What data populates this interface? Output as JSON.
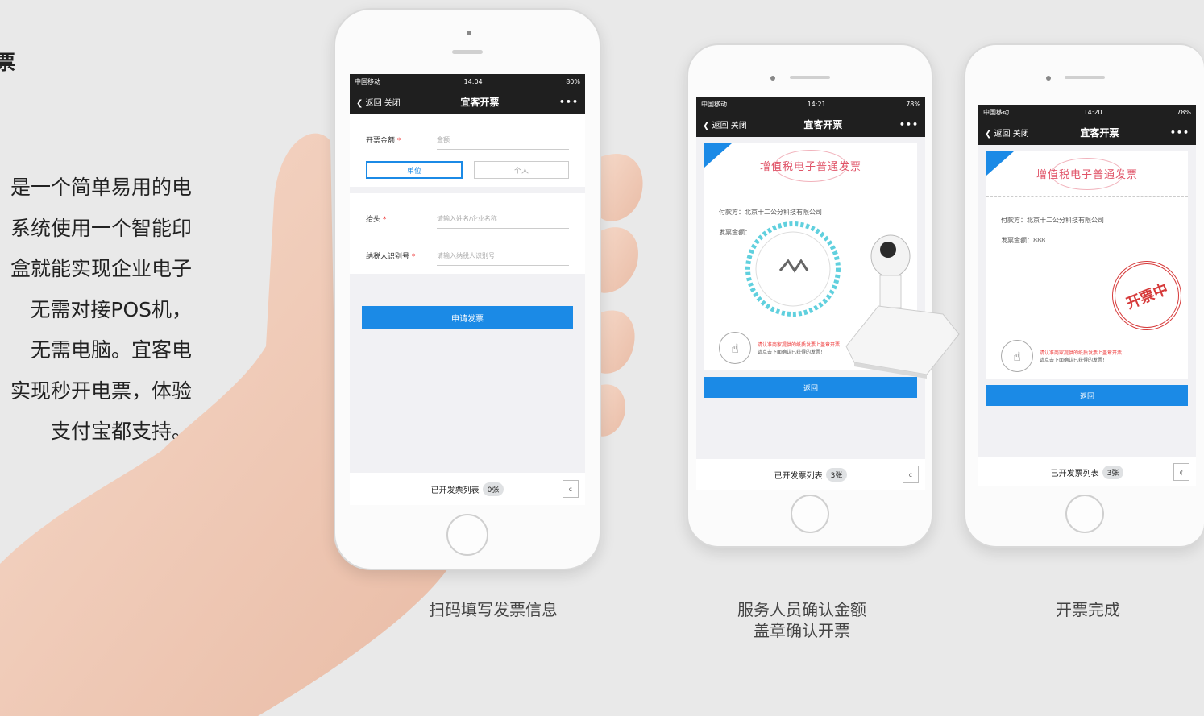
{
  "intro": {
    "title": "票",
    "lines": [
      "是一个简单易用的电",
      "系统使用一个智能印",
      "盒就能实现企业电子",
      "无需对接POS机，",
      "无需电脑。宜客电",
      "实现秒开电票，体验",
      "支付宝都支持。"
    ]
  },
  "phone1": {
    "status_left": "中国移动",
    "status_time": "14:04",
    "status_right": "80%",
    "nav_back": "返回",
    "nav_close": "关闭",
    "nav_title": "宜客开票",
    "nav_more": "•••",
    "field_amount_label": "开票金额",
    "field_amount_placeholder": "金额",
    "type_company": "单位",
    "type_personal": "个人",
    "field_header_label": "抬头",
    "field_header_placeholder": "请输入姓名/企业名称",
    "field_taxid_label": "纳税人识别号",
    "field_taxid_placeholder": "请输入纳税人识别号",
    "apply_button": "申请发票",
    "list_label": "已开发票列表",
    "list_count": "0张"
  },
  "phone2": {
    "status_left": "中国移动",
    "status_time": "14:21",
    "status_right": "78%",
    "nav_back": "返回",
    "nav_close": "关闭",
    "nav_title": "宜客开票",
    "nav_more": "•••",
    "card_title": "增值税电子普通发票",
    "payer_line": "付款方：北京十二公分科技有限公司",
    "amount_label": "发票金额：",
    "notice_line1": "请认准商家提供的纸质发票上盖章开票！",
    "notice_line2": "请点击下面确认已获得的发票！",
    "back_button": "返回",
    "list_label": "已开发票列表",
    "list_count": "3张"
  },
  "phone3": {
    "status_left": "中国移动",
    "status_time": "14:20",
    "status_right": "78%",
    "nav_back": "返回",
    "nav_close": "关闭",
    "nav_title": "宜客开票",
    "nav_more": "•••",
    "card_title": "增值税电子普通发票",
    "payer_line": "付款方：北京十二公分科技有限公司",
    "amount_line": "发票金额：888",
    "stamp_text": "开票中",
    "notice_line1": "请认准商家提供的纸质发票上盖章开票！",
    "notice_line2": "请点击下面确认已获得的发票！",
    "back_button": "返回",
    "list_label": "已开发票列表",
    "list_count": "3张"
  },
  "captions": {
    "step1": "扫码填写发票信息",
    "step2_line1": "服务人员确认金额",
    "step2_line2": "盖章确认开票",
    "step3": "开票完成"
  },
  "colors": {
    "accent": "#1b8ae6",
    "invoice_red": "#e05468",
    "background": "#e9e9e9"
  }
}
